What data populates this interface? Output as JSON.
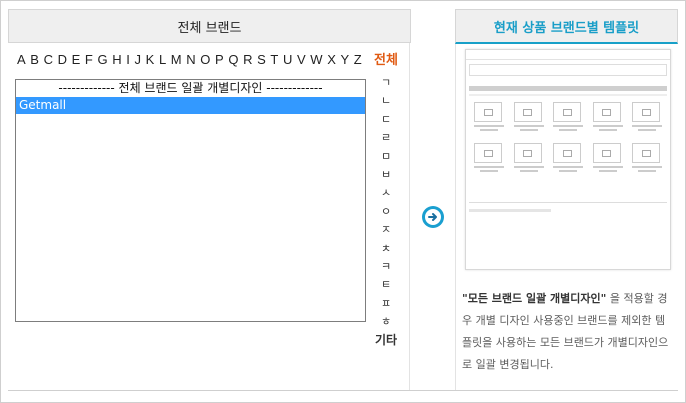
{
  "left_header": "전체 브랜드",
  "right_header": "현재 상품 브랜드별 템플릿",
  "alphabet": [
    "A",
    "B",
    "C",
    "D",
    "E",
    "F",
    "G",
    "H",
    "I",
    "J",
    "K",
    "L",
    "M",
    "N",
    "O",
    "P",
    "Q",
    "R",
    "S",
    "T",
    "U",
    "V",
    "W",
    "X",
    "Y",
    "Z"
  ],
  "consonants": [
    "전체",
    "ㄱ",
    "ㄴ",
    "ㄷ",
    "ㄹ",
    "ㅁ",
    "ㅂ",
    "ㅅ",
    "ㅇ",
    "ㅈ",
    "ㅊ",
    "ㅋ",
    "ㅌ",
    "ㅍ",
    "ㅎ",
    "기타"
  ],
  "brand_list": {
    "separator": "------------- 전체 브랜드 일괄 개별디자인 -------------",
    "items": [
      "Getmall"
    ],
    "selected": "Getmall"
  },
  "description": {
    "quote": "\"모든 브랜드 일괄 개별디자인\"",
    "text": " 을 적용할 경우 개별 디자인 사용중인 브랜드를 제외한 템플릿을 사용하는 모든 브랜드가 개별디자인으로 일괄 변경됩니다."
  },
  "colors": {
    "accent": "#18a0c8",
    "selection": "#3399ff",
    "consonant_highlight": "#e05a12"
  },
  "icons": {
    "apply_arrow": "arrow-right-circle-icon"
  }
}
